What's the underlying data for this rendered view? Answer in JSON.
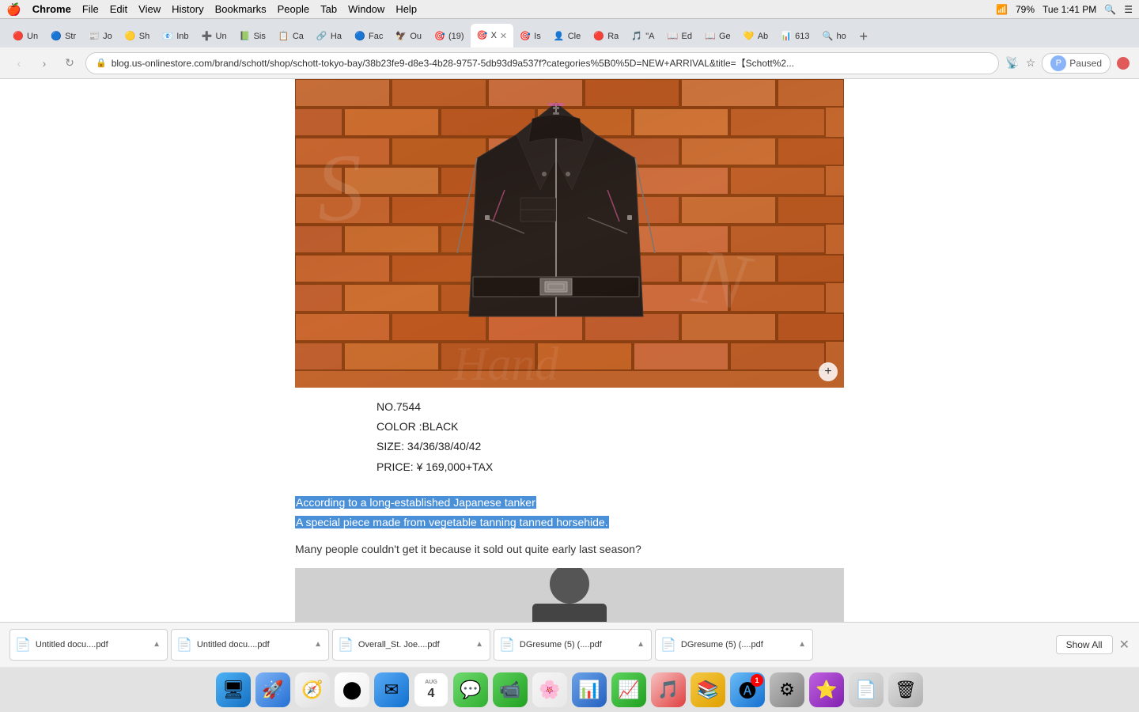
{
  "menubar": {
    "apple": "🍎",
    "items": [
      "Chrome",
      "File",
      "Edit",
      "View",
      "History",
      "Bookmarks",
      "People",
      "Tab",
      "Window",
      "Help"
    ],
    "time": "Tue 1:41 PM",
    "battery": "79%"
  },
  "tabs": [
    {
      "id": "t1",
      "favicon": "🔴",
      "title": "Un",
      "active": false
    },
    {
      "id": "t2",
      "favicon": "🔵",
      "title": "Str",
      "active": false
    },
    {
      "id": "t3",
      "favicon": "📰",
      "title": "Jo",
      "active": false
    },
    {
      "id": "t4",
      "favicon": "🟡",
      "title": "Sh",
      "active": false
    },
    {
      "id": "t5",
      "favicon": "📧",
      "title": "Inb",
      "active": false
    },
    {
      "id": "t6",
      "favicon": "➕",
      "title": "Un",
      "active": false
    },
    {
      "id": "t7",
      "favicon": "📗",
      "title": "Sis",
      "active": false
    },
    {
      "id": "t8",
      "favicon": "📋",
      "title": "Ca",
      "active": false
    },
    {
      "id": "t9",
      "favicon": "🔗",
      "title": "Ha",
      "active": false
    },
    {
      "id": "t10",
      "favicon": "🔵",
      "title": "Fac",
      "active": false
    },
    {
      "id": "t11",
      "favicon": "🦅",
      "title": "Ou",
      "active": false
    },
    {
      "id": "t12",
      "favicon": "🎯",
      "title": "(19)",
      "active": false
    },
    {
      "id": "t13",
      "favicon": "🎯",
      "title": "X",
      "active": true
    },
    {
      "id": "t14",
      "favicon": "🎯",
      "title": "Is",
      "active": false
    },
    {
      "id": "t15",
      "favicon": "👤",
      "title": "Cle",
      "active": false
    },
    {
      "id": "t16",
      "favicon": "🔴",
      "title": "Ra",
      "active": false
    },
    {
      "id": "t17",
      "favicon": "🎵",
      "title": "A",
      "active": false
    },
    {
      "id": "t18",
      "favicon": "📖",
      "title": "Ed",
      "active": false
    },
    {
      "id": "t19",
      "favicon": "📖",
      "title": "Ge",
      "active": false
    },
    {
      "id": "t20",
      "favicon": "💛",
      "title": "Ab",
      "active": false
    },
    {
      "id": "t21",
      "favicon": "📊",
      "title": "613",
      "active": false
    },
    {
      "id": "t22",
      "favicon": "🔍",
      "title": "ho",
      "active": false
    }
  ],
  "addressbar": {
    "url": "blog.us-onlinestore.com/brand/schott/shop/schott-tokyo-bay/38b23fe9-d8e3-4b28-9757-5db93d9a537f?categories%5B0%5D=NEW+ARRIVAL&title=【Schott%2...",
    "paused_label": "Paused"
  },
  "product": {
    "number": "NO.7544",
    "color": "COLOR :BLACK",
    "size": "SIZE: 34/36/38/40/42",
    "price": "PRICE: ¥ 169,000+TAX",
    "highlight1": "According to a long-established Japanese tanker",
    "highlight2": "A special piece made from vegetable tanning tanned horsehide.",
    "description": "Many people couldn't get it because it sold out quite early last season?"
  },
  "downloads": [
    {
      "filename": "Untitled docu....pdf",
      "sub": "",
      "id": "dl1"
    },
    {
      "filename": "Untitled docu....pdf",
      "sub": "",
      "id": "dl2"
    },
    {
      "filename": "Overall_St. Joe....pdf",
      "sub": "",
      "id": "dl3"
    },
    {
      "filename": "DGresume (5) (....pdf",
      "sub": "",
      "id": "dl4"
    },
    {
      "filename": "DGresume (5) (....pdf",
      "sub": "",
      "id": "dl5"
    }
  ],
  "show_all_label": "Show All",
  "dock": {
    "items": [
      {
        "name": "Finder",
        "class": "dock-finder",
        "icon": "🖥"
      },
      {
        "name": "Launchpad",
        "class": "dock-launchpad",
        "icon": "🚀"
      },
      {
        "name": "Safari",
        "class": "dock-safari",
        "icon": "🧭"
      },
      {
        "name": "Chrome",
        "class": "dock-chrome",
        "icon": "⚙"
      },
      {
        "name": "Mail",
        "class": "dock-mail",
        "icon": "✉"
      },
      {
        "name": "Calendar",
        "class": "dock-calendar",
        "icon": "📅"
      },
      {
        "name": "Messages",
        "class": "dock-messages",
        "icon": "💬"
      },
      {
        "name": "FaceTime",
        "class": "dock-facetime",
        "icon": "📹"
      },
      {
        "name": "Photos",
        "class": "dock-photos",
        "icon": "🌸"
      },
      {
        "name": "Keynote",
        "class": "dock-keynote",
        "icon": "📊"
      },
      {
        "name": "Numbers",
        "class": "dock-numbers",
        "icon": "📈"
      },
      {
        "name": "Music",
        "class": "dock-music",
        "icon": "🎵"
      },
      {
        "name": "Books",
        "class": "dock-books",
        "icon": "📚"
      },
      {
        "name": "App Store",
        "class": "dock-appstore",
        "icon": "🅐",
        "badge": "1"
      },
      {
        "name": "System Preferences",
        "class": "dock-sysprefs",
        "icon": "⚙"
      },
      {
        "name": "Capturismo",
        "class": "dock-capturismo",
        "icon": "⭐"
      },
      {
        "name": "Finder2",
        "class": "dock-finder2",
        "icon": "📄"
      },
      {
        "name": "Trash",
        "class": "dock-trash",
        "icon": "🗑"
      }
    ]
  }
}
